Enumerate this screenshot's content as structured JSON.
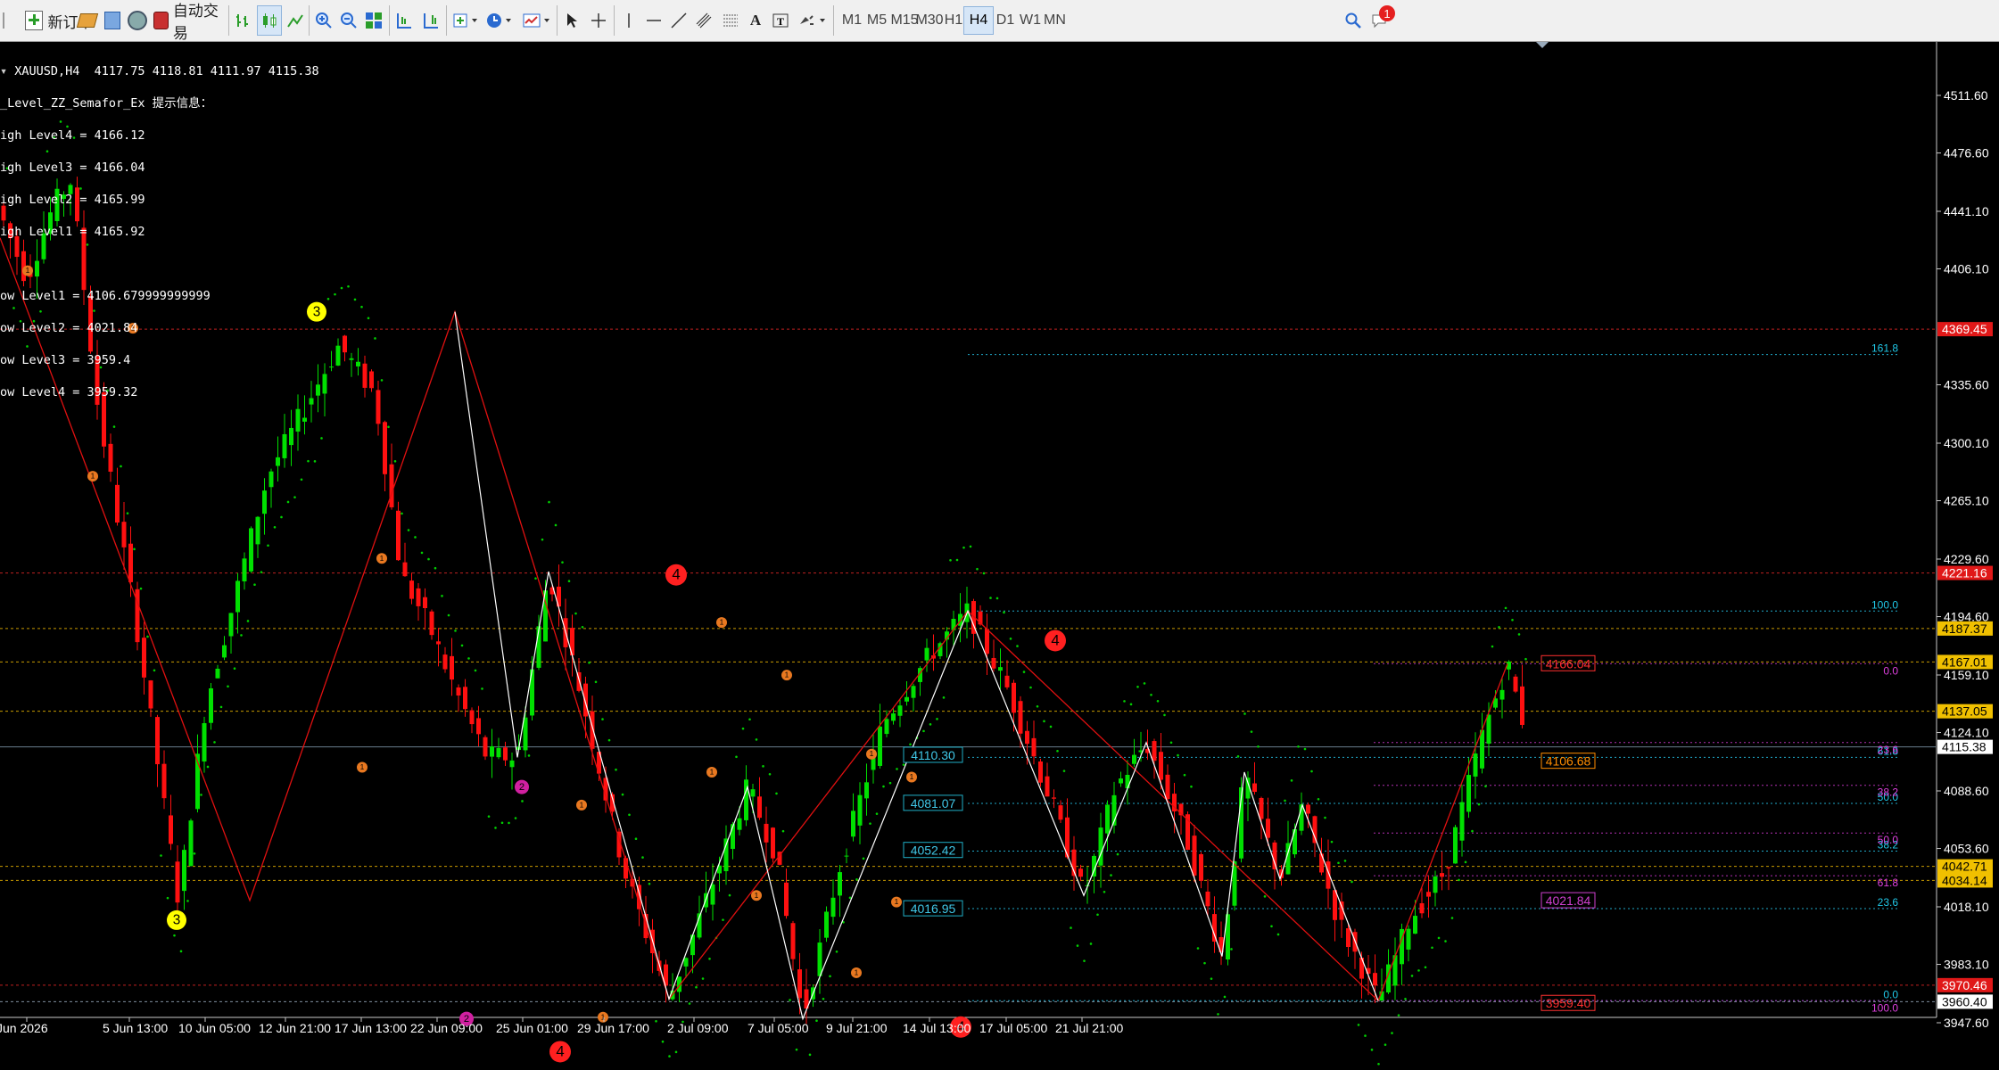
{
  "toolbar": {
    "new_order": "新订单",
    "auto_trading": "自动交易",
    "timeframes": [
      "M1",
      "M5",
      "M15",
      "M30",
      "H1",
      "H4",
      "D1",
      "W1",
      "MN"
    ],
    "active_timeframe": "H4",
    "notification_count": "1"
  },
  "chart_header": {
    "symbol_line": "XAUUSD,H4  4117.75 4118.81 4111.97 4115.38",
    "indicator_title": "_Level_ZZ_Semafor_Ex 提示信息：",
    "high_levels": [
      "igh Level4 = 4166.12",
      "igh Level3 = 4166.04",
      "igh Level2 = 4165.99",
      "igh Level1 = 4165.92"
    ],
    "low_levels": [
      "ow Level1 = 4106.679999999999",
      "ow Level2 = 4021.84",
      "ow Level3 = 3959.4",
      "ow Level4 = 3959.32"
    ]
  },
  "chart_data": {
    "type": "candlestick",
    "symbol": "XAUUSD",
    "timeframe": "H4",
    "ohlc_current": {
      "open": 4117.75,
      "high": 4118.81,
      "low": 4111.97,
      "close": 4115.38
    },
    "ylim": [
      3938,
      4538
    ],
    "price_ticks": [
      "4511.60",
      "4476.60",
      "4441.10",
      "4406.10",
      "4335.60",
      "4300.10",
      "4265.10",
      "4229.60",
      "4194.60",
      "4159.10",
      "4124.10",
      "4088.60",
      "4053.60",
      "4018.10",
      "3983.10",
      "3947.60"
    ],
    "time_ticks": [
      "Jun 2026",
      "5 Jun 13:00",
      "10 Jun 05:00",
      "12 Jun 21:00",
      "17 Jun 13:00",
      "22 Jun 09:00",
      "25 Jun 01:00",
      "29 Jun 17:00",
      "2 Jul 09:00",
      "7 Jul 05:00",
      "9 Jul 21:00",
      "14 Jul 13:00",
      "17 Jul 05:00",
      "21 Jul 21:00"
    ],
    "zigzag_red": [
      [
        0,
        4425
      ],
      [
        280,
        4022
      ],
      [
        510,
        4380
      ],
      [
        750,
        3962
      ],
      [
        1085,
        4198
      ],
      [
        1545,
        3961
      ],
      [
        1690,
        4166
      ]
    ],
    "zigzag_white": [
      [
        510,
        4380
      ],
      [
        580,
        4109
      ],
      [
        615,
        4222
      ],
      [
        750,
        3962
      ],
      [
        838,
        4091
      ],
      [
        900,
        3950
      ],
      [
        1085,
        4198
      ],
      [
        1215,
        4025
      ],
      [
        1285,
        4118
      ],
      [
        1370,
        3988
      ],
      [
        1395,
        4100
      ],
      [
        1435,
        4035
      ],
      [
        1460,
        4080
      ],
      [
        1545,
        3961
      ]
    ],
    "horizontal_levels": [
      {
        "price": 4369.45,
        "label": "4369.45",
        "color": "#e02020",
        "style": "red"
      },
      {
        "price": 4221.16,
        "label": "4221.16",
        "color": "#e02020",
        "style": "red"
      },
      {
        "price": 4187.37,
        "label": "4187.37",
        "color": "#f0b000",
        "style": "gold"
      },
      {
        "price": 4167.01,
        "label": "4167.01",
        "color": "#f0b000",
        "style": "gold"
      },
      {
        "price": 4137.05,
        "label": "4137.05",
        "color": "#f0b000",
        "style": "gold"
      },
      {
        "price": 4115.38,
        "label": "4115.38",
        "color": "#ffffff",
        "style": "current"
      },
      {
        "price": 4042.71,
        "label": "4042.71",
        "color": "#f0b000",
        "style": "gold"
      },
      {
        "price": 4034.14,
        "label": "4034.14",
        "color": "#f0b000",
        "style": "gold"
      },
      {
        "price": 3970.46,
        "label": "3970.46",
        "color": "#e02020",
        "style": "red"
      },
      {
        "price": 3960.4,
        "label": "3960.40",
        "color": "#ffffff",
        "style": "white"
      }
    ],
    "fib_cyan": [
      {
        "price": 4354,
        "label": "161.8"
      },
      {
        "price": 4198,
        "label": "100.0"
      },
      {
        "price": 4109,
        "label": "61.8"
      },
      {
        "price": 4081,
        "label": "50.0"
      },
      {
        "price": 4052,
        "label": "38.2"
      },
      {
        "price": 4017,
        "label": "23.6"
      },
      {
        "price": 3961,
        "label": "0.0"
      }
    ],
    "fib_cyan_boxes": [
      "4110.30",
      "4081.07",
      "4052.42",
      "4016.95"
    ],
    "fib_magenta": [
      {
        "price": 4166,
        "label": "0.0"
      },
      {
        "price": 4118,
        "label": "23.6"
      },
      {
        "price": 4092,
        "label": "38.2"
      },
      {
        "price": 4063,
        "label": "50.0"
      },
      {
        "price": 4037,
        "label": "61.8"
      },
      {
        "price": 3961,
        "label": "100.0"
      }
    ],
    "right_boxes": [
      {
        "price": 4166,
        "label": "4166.04",
        "color": "#ff3030"
      },
      {
        "price": 4106.68,
        "label": "4106.68",
        "color": "#ff8c00"
      },
      {
        "price": 4021.84,
        "label": "4021.84",
        "color": "#d040d0"
      },
      {
        "price": 3959.4,
        "label": "3959.40",
        "color": "#ff3030"
      }
    ],
    "semafor_markers": [
      {
        "x": 355,
        "price": 4380,
        "text": "3",
        "color": "#ffff00",
        "size": 11
      },
      {
        "x": 198,
        "price": 4010,
        "text": "3",
        "color": "#ffff00",
        "size": 11
      },
      {
        "x": 758,
        "price": 4220,
        "text": "4",
        "color": "#ff2020",
        "size": 12
      },
      {
        "x": 1183,
        "price": 4180,
        "text": "4",
        "color": "#ff2020",
        "size": 12
      },
      {
        "x": 1077,
        "price": 3945,
        "text": "4",
        "color": "#ff2020",
        "size": 12
      },
      {
        "x": 628,
        "price": 3930,
        "text": "4",
        "color": "#ff2020",
        "size": 12
      },
      {
        "x": 585,
        "price": 4091,
        "text": "2",
        "color": "#d020a0",
        "size": 8
      },
      {
        "x": 523,
        "price": 3950,
        "text": "2",
        "color": "#d020a0",
        "size": 8
      },
      {
        "x": 31,
        "price": 4405,
        "text": "1",
        "color": "#e87820",
        "size": 6
      },
      {
        "x": 149,
        "price": 4370,
        "text": "1",
        "color": "#e87820",
        "size": 6
      },
      {
        "x": 104,
        "price": 4280,
        "text": "1",
        "color": "#e87820",
        "size": 6
      },
      {
        "x": 428,
        "price": 4230,
        "text": "1",
        "color": "#e87820",
        "size": 6
      },
      {
        "x": 406,
        "price": 4103,
        "text": "1",
        "color": "#e87820",
        "size": 6
      },
      {
        "x": 652,
        "price": 4080,
        "text": "1",
        "color": "#e87820",
        "size": 6
      },
      {
        "x": 676,
        "price": 3951,
        "text": "1",
        "color": "#e87820",
        "size": 6
      },
      {
        "x": 809,
        "price": 4191,
        "text": "1",
        "color": "#e87820",
        "size": 6
      },
      {
        "x": 798,
        "price": 4100,
        "text": "1",
        "color": "#e87820",
        "size": 6
      },
      {
        "x": 848,
        "price": 4025,
        "text": "1",
        "color": "#e87820",
        "size": 6
      },
      {
        "x": 882,
        "price": 4159,
        "text": "1",
        "color": "#e87820",
        "size": 6
      },
      {
        "x": 977,
        "price": 4111,
        "text": "1",
        "color": "#e87820",
        "size": 6
      },
      {
        "x": 960,
        "price": 3978,
        "text": "1",
        "color": "#e87820",
        "size": 6
      },
      {
        "x": 1005,
        "price": 4021,
        "text": "1",
        "color": "#e87820",
        "size": 6
      },
      {
        "x": 1022,
        "price": 4097,
        "text": "1",
        "color": "#e87820",
        "size": 6
      }
    ],
    "grid": false,
    "current_price": 4115.38
  }
}
